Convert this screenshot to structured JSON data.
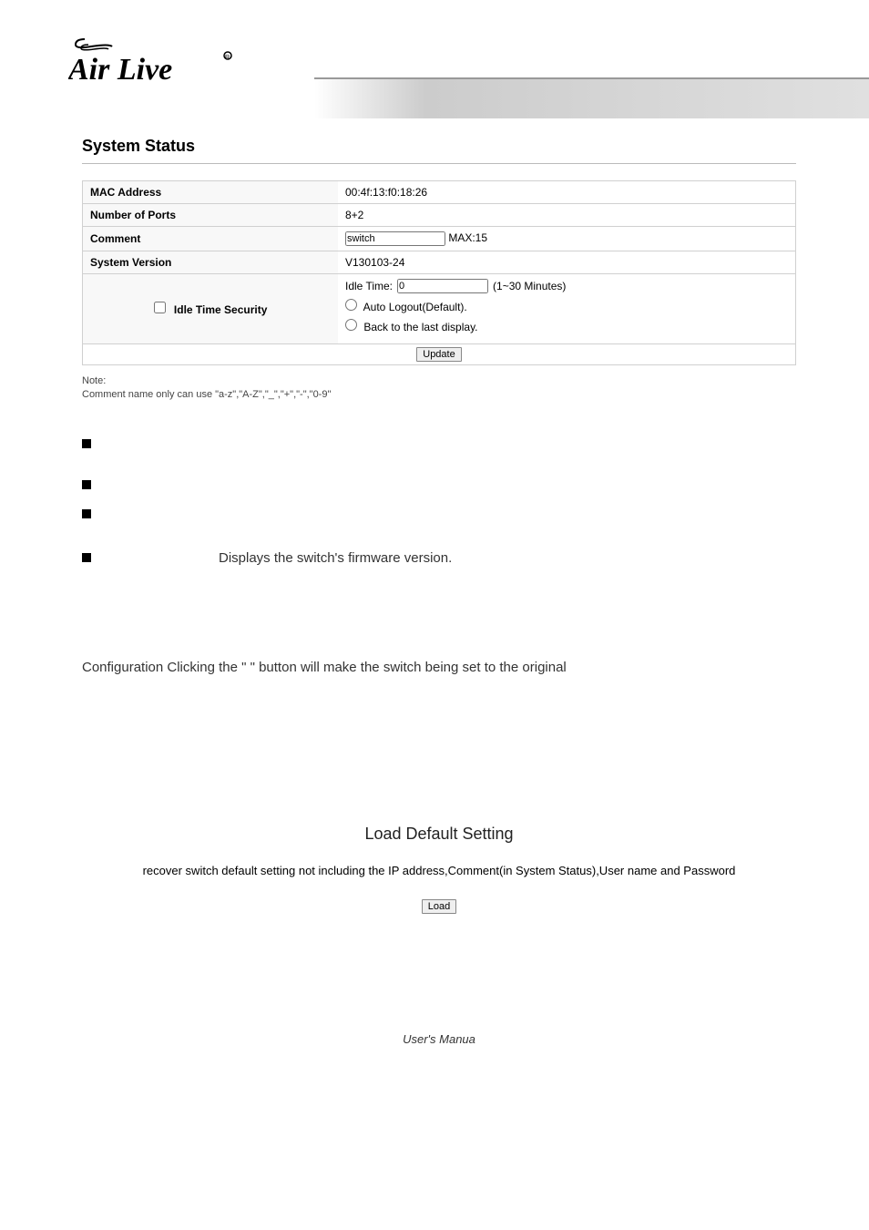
{
  "brand": "Air Live",
  "system_status": {
    "title": "System Status",
    "rows": {
      "mac_address_label": "MAC Address",
      "mac_address_value": "00:4f:13:f0:18:26",
      "ports_label": "Number of Ports",
      "ports_value": "8+2",
      "comment_label": "Comment",
      "comment_value": "switch",
      "comment_max": "MAX:15",
      "version_label": "System Version",
      "version_value": "V130103-24",
      "idle_label": "Idle Time Security",
      "idle_time_label": "Idle Time:",
      "idle_time_value": "0",
      "idle_time_hint": "(1~30 Minutes)",
      "radio_auto": "Auto Logout(Default).",
      "radio_back": "Back to the last display.",
      "update_btn": "Update"
    },
    "note_label": "Note:",
    "note_text": "Comment name only can use \"a-z\",\"A-Z\",\"_\",\"+\",\"-\",\"0-9\""
  },
  "bullets": {
    "b4_text": "Displays the switch's firmware version."
  },
  "config_para": "Configuration Clicking the \"          \" button will make the switch being set to the original",
  "load_default": {
    "title": "Load Default Setting",
    "text": "recover switch default setting not including the IP address,Comment(in System Status),User name and Password",
    "btn": "Load"
  },
  "footer": "User's Manua"
}
